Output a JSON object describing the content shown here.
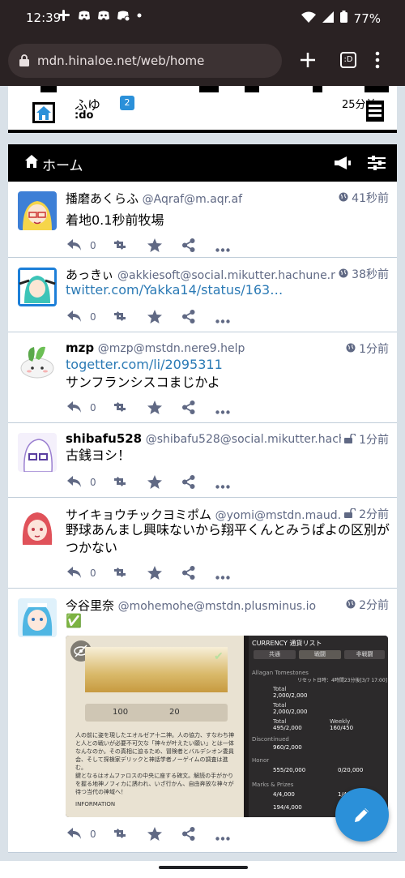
{
  "statusbar": {
    "time": "12:39",
    "battery": "77%"
  },
  "browser": {
    "url": "mdn.hinaloe.net/web/home",
    "tab_label": ":D"
  },
  "top_column": {
    "display_name": "ふゆ",
    "badge": "2",
    "domain": ":do",
    "time": "25分前"
  },
  "column_header": {
    "title": "ホーム"
  },
  "statuses": [
    {
      "display_name": "播磨あくらふ",
      "acct": "@Aqraf@m.aqr.af",
      "time": "41秒前",
      "visibility": "public",
      "text": "着地0.1秒前牧場",
      "replies": "0"
    },
    {
      "display_name": "あっきぃ",
      "acct": "@akkiesoft@social.mikutter.hachune.net",
      "time": "38秒前",
      "visibility": "public",
      "link": "twitter.com/Yakka14/status/163…",
      "replies": "0"
    },
    {
      "display_name": "mzp",
      "acct": "@mzp@mstdn.nere9.help",
      "time": "1分前",
      "visibility": "public",
      "link": "togetter.com/li/2095311",
      "text": "サンフランシスコまじかよ",
      "replies": "0"
    },
    {
      "display_name": "shibafu528",
      "acct": "@shibafu528@social.mikutter.hachun…",
      "time": "1分前",
      "visibility": "unlisted",
      "text": "古銭ヨシ！",
      "replies": "0"
    },
    {
      "display_name": "サイキョウチックヨミポム",
      "acct": "@yomi@mstdn.maud…",
      "time": "2分前",
      "visibility": "unlisted",
      "text": "野球あんまし興味ないから翔平くんとみうぱよの区別が",
      "text2": "つかない",
      "replies": "0"
    },
    {
      "display_name": "今谷里奈",
      "acct": "@mohemohe@mstdn.plusminus.io",
      "time": "2分前",
      "visibility": "public",
      "text": "✅",
      "replies": "0"
    }
  ],
  "media": {
    "game_title": "CURRENCY 通貨リスト",
    "tabs": [
      "共通",
      "戦闘",
      "非戦闘"
    ],
    "section1": "Allagan Tomestones",
    "reset": "リセット日時：4時間23分後[3/7 17:00]",
    "rows": [
      {
        "label": "Total",
        "value": "2,000/2,000"
      },
      {
        "label": "Total",
        "value": "2,000/2,000"
      },
      {
        "label": "Total",
        "value": "495/2,000",
        "extra_label": "Weekly",
        "extra": "160/450"
      }
    ],
    "discontinued": "Discontinued",
    "disc_value": "960/2,000",
    "honor": "Honor",
    "honor_value": "555/20,000",
    "honor_value2": "0/20,000",
    "marks": "Marks & Prizes",
    "marks_value": "4/4,000",
    "marks_value2": "1/4,0",
    "marks_value3": "194/4,000",
    "num1": "100",
    "num2": "20",
    "lore": "人の前に姿を現したエオルゼア十二神。人の協力、すなわち神と人との戦いが必要不可欠な「神々が叶えたい願い」とは一体なんなのか。その真相に迫るため、冒険者とバルデシオン委員会、そして探検家デリックと神話学者ノーゲイムの調査は進む。",
    "lore2": "鍵となるはオムファロスの中央に座する碑文。解読の手がかりを握る地神ノフィカに誘われ、いざ行かん、自由奔放な神々が待つ当代の神域へ！",
    "info": "INFORMATION"
  },
  "colors": {
    "accent": "#2b90d9",
    "link": "#2b7ab5",
    "meta": "#606984",
    "bg": "#d9e1e8"
  }
}
